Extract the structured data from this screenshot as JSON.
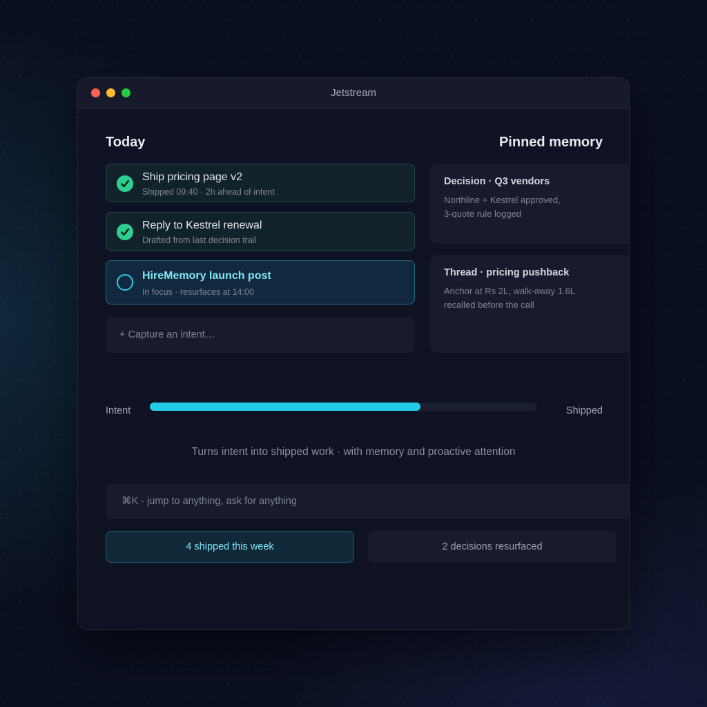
{
  "window": {
    "title": "Jetstream"
  },
  "today": {
    "title": "Today",
    "tasks": [
      {
        "title": "Ship pricing page v2",
        "subtitle": "Shipped 09:40 · 2h ahead of intent",
        "status": "done"
      },
      {
        "title": "Reply to Kestrel renewal",
        "subtitle": "Drafted from last decision trail",
        "status": "done"
      },
      {
        "title": "HireMemory launch post",
        "subtitle": "In focus · resurfaces at 14:00",
        "status": "focus"
      }
    ],
    "capture_placeholder": "+ Capture an intent…"
  },
  "pinned": {
    "title": "Pinned memory",
    "cards": [
      {
        "title": "Decision · Q3 vendors",
        "line1": "Northline + Kestrel approved,",
        "line2": "3-quote rule logged"
      },
      {
        "title": "Thread · pricing pushback",
        "line1": "Anchor at Rs 2L, walk-away 1.6L",
        "line2": "recalled before the call"
      }
    ]
  },
  "progress": {
    "left_label": "Intent",
    "right_label": "Shipped",
    "fraction": 0.7
  },
  "tagline": "Turns intent into shipped work · with memory and proactive attention",
  "command_bar": {
    "placeholder": "⌘K · jump to anything, ask for anything"
  },
  "stats": {
    "shipped": "4 shipped this week",
    "resurfaced": "2 decisions resurfaced"
  },
  "colors": {
    "accent": "#22cbe8",
    "done": "#2fd08f",
    "background": "#0b1020",
    "window": "#0e1222"
  },
  "icons": {
    "done": "check-circle-icon",
    "focus": "empty-circle-icon"
  }
}
